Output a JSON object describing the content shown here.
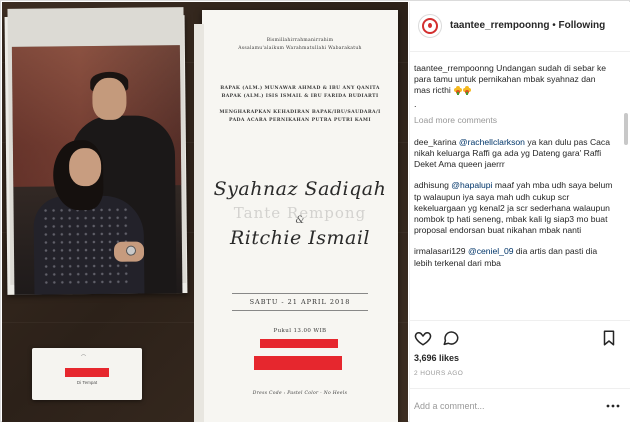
{
  "header": {
    "username": "taantee_rrempoonng",
    "separator": " • ",
    "follow_label": "Following"
  },
  "invitation": {
    "bismillah": "Bismillahirrahmanirrahim",
    "salam": "Assalamu'alaikum Warahmatullahi Wabarakatuh",
    "parents_line1": "BAPAK (ALM.) MUNAWAR AHMAD & IBU ANY QANITA",
    "parents_line2": "BAPAK (ALM.) ISIS ISMAIL & IBU FARIDA BUDIARTI",
    "request_line1": "MENGHARAPKAN KEHADIRAN BAPAK/IBU/SAUDARA/I",
    "request_line2": "PADA ACARA PERNIKAHAN PUTRA PUTRI KAMI",
    "bride": "Syahnaz Sadiqah",
    "amp": "&",
    "groom": "Ritchie Ismail",
    "date": "SABTU - 21 APRIL 2018",
    "time": "Pukul 13.00 WIB",
    "dress_code": "Dress Code : Pastel Color - No Heels",
    "watermark": "Tante Rempong"
  },
  "small_card": {
    "label": "Di Tempat"
  },
  "comments": [
    {
      "user": "taantee_rrempoonng",
      "text": " Undangan sudah di sebar ke para tamu untuk pernikahan mbak syahnaz dan mas ricthi ",
      "type": "caption"
    },
    {
      "user": "dee_karina",
      "mention": "@rachellclarkson",
      "text": " ya kan dulu pas Caca nikah keluarga Raffi ga ada yg Dateng gara' Raffi Deket Ama queen jaerrr"
    },
    {
      "user": "adhisung",
      "mention": "@hapalupi",
      "text": " maaf yah mba udh saya belum tp walaupun iya saya mah udh cukup scr kekeluargaan yg kenal2 ja scr sederhana walaupun nombok tp hati seneng, mbak kali lg siap3 mo buat proposal endorsan buat nikahan mbak nanti"
    },
    {
      "user": "irmalasari129",
      "mention": "@ceniel_09",
      "text": " dia artis dan pasti dia lebih terkenal dari mba"
    }
  ],
  "caption_dot": ".",
  "load_more_label": "Load more comments",
  "likes_label": "3,696 likes",
  "time_label": "2 HOURS AGO",
  "add_comment_placeholder": "Add a comment...",
  "colors": {
    "accent_red": "#e6272e",
    "mention_blue": "#003569",
    "muted_gray": "#999999"
  }
}
